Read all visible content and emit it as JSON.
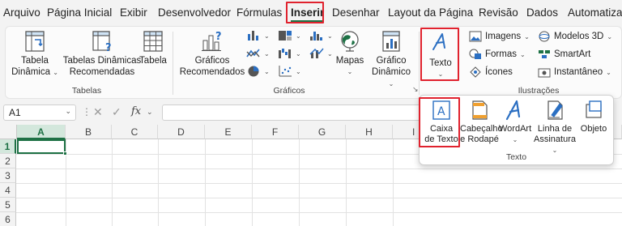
{
  "menubar": {
    "tabs": [
      "Arquivo",
      "Página Inicial",
      "Exibir",
      "Desenvolvedor",
      "Fórmulas",
      "Inserir",
      "Desenhar",
      "Layout da Página",
      "Revisão",
      "Dados",
      "Automatiza"
    ],
    "active": "Inserir"
  },
  "ribbon": {
    "tabelas": {
      "label": "Tabelas",
      "tabela_dinamica": [
        "Tabela",
        "Dinâmica"
      ],
      "tabelas_dinamicas_recomendadas": [
        "Tabelas Dinâmicas",
        "Recomendadas"
      ],
      "tabela": "Tabela"
    },
    "graficos": {
      "label": "Gráficos",
      "graficos_recomendados": [
        "Gráficos",
        "Recomendados"
      ],
      "mapas": "Mapas",
      "grafico_dinamico": [
        "Gráfico",
        "Dinâmico"
      ]
    },
    "texto": {
      "label": "Texto"
    },
    "ilustracoes": {
      "label": "Ilustrações",
      "imagens": "Imagens",
      "formas": "Formas",
      "icones": "Ícones",
      "modelos_3d": "Modelos 3D",
      "smartart": "SmartArt",
      "instantaneo": "Instantâneo"
    }
  },
  "formula_bar": {
    "name_box": "A1",
    "fx": "fx"
  },
  "grid": {
    "columns": [
      "A",
      "B",
      "C",
      "D",
      "E",
      "F",
      "G",
      "H",
      "I"
    ],
    "rows": [
      "1",
      "2",
      "3",
      "4",
      "5",
      "6"
    ],
    "active_cell": "A1"
  },
  "dropdown": {
    "label": "Texto",
    "items": [
      {
        "label": [
          "Caixa",
          "de Texto"
        ]
      },
      {
        "label": [
          "Cabeçalho",
          "e Rodapé"
        ]
      },
      {
        "label": [
          "WordArt",
          ""
        ]
      },
      {
        "label": [
          "Linha de",
          "Assinatura"
        ]
      },
      {
        "label": [
          "Objeto",
          ""
        ]
      }
    ]
  },
  "colors": {
    "excel_green": "#1e7145",
    "highlight_red": "#e0222e",
    "icon_blue": "#2b6fc2"
  }
}
